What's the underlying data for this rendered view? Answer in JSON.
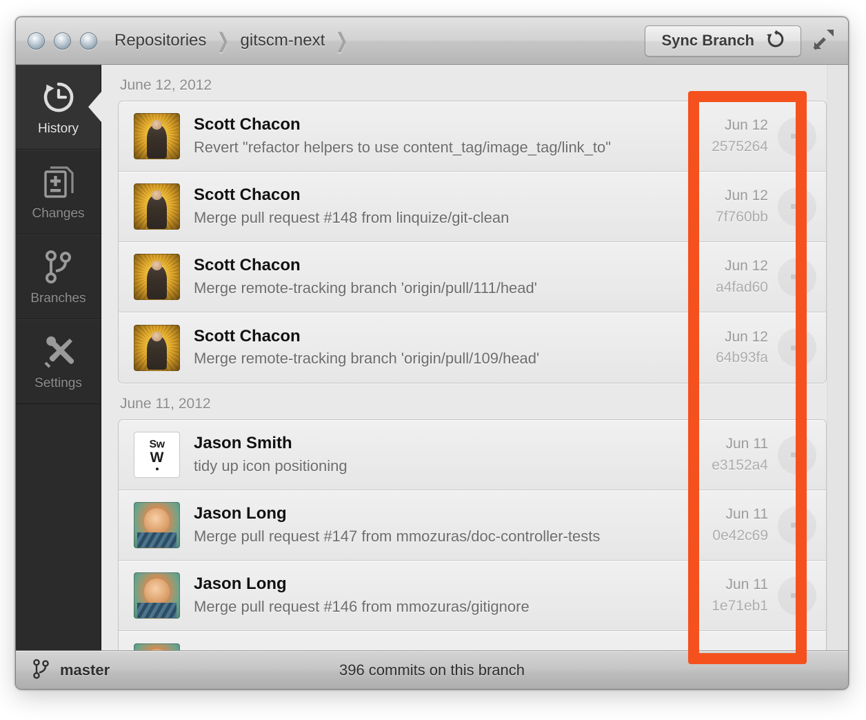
{
  "window": {
    "traffic_lights": [
      "close",
      "minimize",
      "zoom"
    ],
    "breadcrumb": [
      "Repositories",
      "gitscm-next"
    ],
    "breadcrumb_separator": "›",
    "sync_button_label": "Sync Branch",
    "sync_icon": "refresh-icon",
    "fullscreen_icon": "expand-icon"
  },
  "sidebar": {
    "items": [
      {
        "label": "History",
        "icon": "history-clock-icon",
        "active": true
      },
      {
        "label": "Changes",
        "icon": "file-changes-icon",
        "active": false
      },
      {
        "label": "Branches",
        "icon": "branch-fork-icon",
        "active": false
      },
      {
        "label": "Settings",
        "icon": "wrench-screwdriver-icon",
        "active": false
      }
    ]
  },
  "history": {
    "groups": [
      {
        "date_header": "June 12, 2012",
        "commits": [
          {
            "author": "Scott Chacon",
            "message": "Revert \"refactor helpers to use content_tag/image_tag/link_to\"",
            "date": "Jun 12",
            "sha": "2575264",
            "avatar": "scott",
            "more_icon": "more-options-icon"
          },
          {
            "author": "Scott Chacon",
            "message": "Merge pull request #148 from linquize/git-clean",
            "date": "Jun 12",
            "sha": "7f760bb",
            "avatar": "scott",
            "more_icon": "more-options-icon"
          },
          {
            "author": "Scott Chacon",
            "message": "Merge remote-tracking branch 'origin/pull/111/head'",
            "date": "Jun 12",
            "sha": "a4fad60",
            "avatar": "scott",
            "more_icon": "more-options-icon"
          },
          {
            "author": "Scott Chacon",
            "message": "Merge remote-tracking branch 'origin/pull/109/head'",
            "date": "Jun 12",
            "sha": "64b93fa",
            "avatar": "scott",
            "more_icon": "more-options-icon"
          }
        ]
      },
      {
        "date_header": "June 11, 2012",
        "commits": [
          {
            "author": "Jason Smith",
            "message": "tidy up icon positioning",
            "date": "Jun 11",
            "sha": "e3152a4",
            "avatar": "sww",
            "avatar_text_top": "Sw",
            "avatar_text_mid": "W",
            "more_icon": "more-options-icon"
          },
          {
            "author": "Jason Long",
            "message": "Merge pull request #147 from mmozuras/doc-controller-tests",
            "date": "Jun 11",
            "sha": "0e42c69",
            "avatar": "jl",
            "more_icon": "more-options-icon"
          },
          {
            "author": "Jason Long",
            "message": "Merge pull request #146 from mmozuras/gitignore",
            "date": "Jun 11",
            "sha": "1e71eb1",
            "avatar": "jl",
            "more_icon": "more-options-icon"
          }
        ]
      }
    ]
  },
  "statusbar": {
    "branch_icon": "branch-fork-icon",
    "branch_name": "master",
    "commit_count_text": "396 commits on this branch"
  },
  "annotation": {
    "type": "rectangle-highlight",
    "color": "#f4511e",
    "target": "commit-metadata-column"
  }
}
